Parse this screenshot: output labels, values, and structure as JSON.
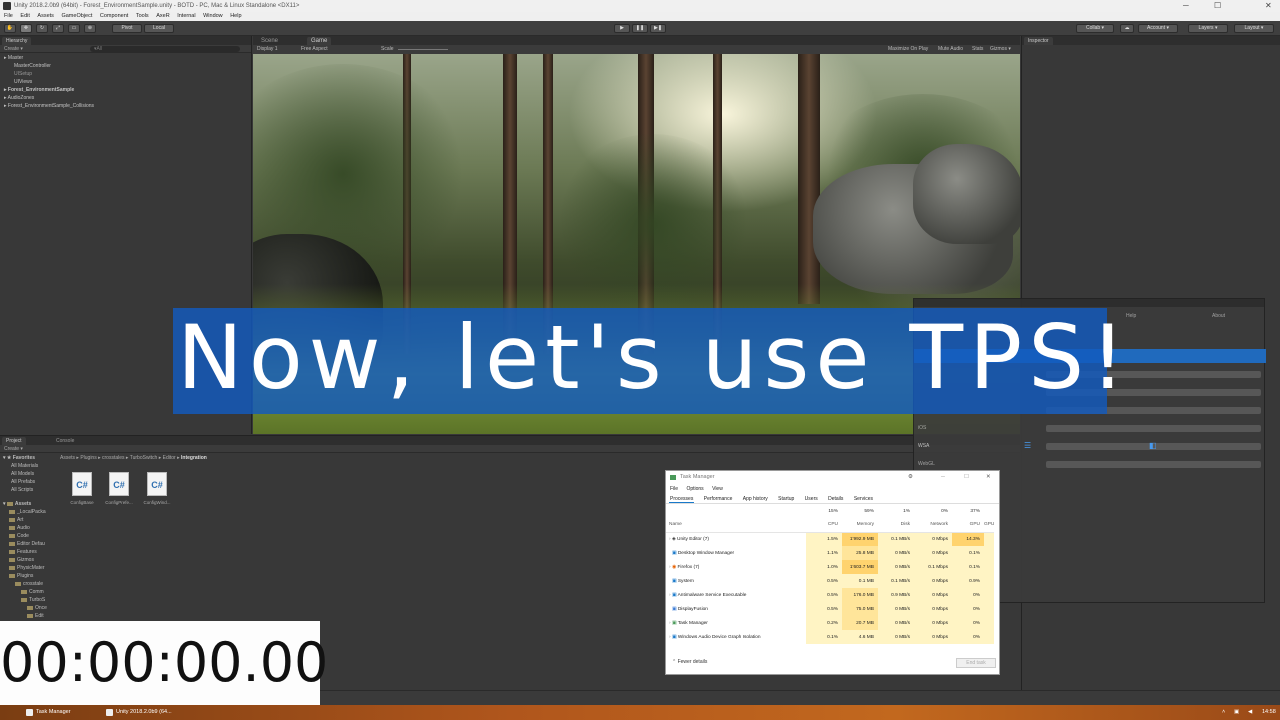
{
  "window": {
    "title": "Unity 2018.2.0b9 (64bit) - Forest_EnvironmentSample.unity - BOTD - PC, Mac & Linux Standalone <DX11>",
    "minimize": "─",
    "maximize": "☐",
    "close": "✕"
  },
  "menu": [
    "File",
    "Edit",
    "Assets",
    "GameObject",
    "Component",
    "Tools",
    "AxeR",
    "Internal",
    "Window",
    "Help"
  ],
  "toolbar": {
    "pivot": "Pivot",
    "local": "Local",
    "collab": "Collab ▾",
    "account": "Account ▾",
    "layers": "Layers ▾",
    "layout": "Layout ▾"
  },
  "hierarchy": {
    "tab": "Hierarchy",
    "create": "Create ▾",
    "search_placeholder": "▾All",
    "items": [
      "Master",
      "MasterController",
      "UISetup",
      "UIViews",
      "Forest_EnvironmentSample",
      "AudioZones",
      "Forest_EnvironmentSample_Collisions"
    ]
  },
  "scene_tabs": {
    "scene": "Scene",
    "game": "Game",
    "display": "Display 1",
    "aspect": "Free Aspect",
    "scale_label": "Scale",
    "maximize": "Maximize On Play",
    "mute": "Mute Audio",
    "stats": "Stats",
    "gizmos": "Gizmos ▾"
  },
  "inspector": {
    "tab": "Inspector"
  },
  "banner": {
    "text": "Now, let's use TPS!"
  },
  "project": {
    "tab_project": "Project",
    "tab_console": "Console",
    "create": "Create ▾",
    "breadcrumb": [
      "Assets",
      "Plugins",
      "crosstales",
      "TurboSwitch",
      "Editor",
      "Integration"
    ],
    "favorites_title": "Favorites",
    "favorites": [
      "All Materials",
      "All Models",
      "All Prefabs",
      "All Scripts"
    ],
    "assets_title": "Assets",
    "assets": [
      "_LocalPacka",
      "Art",
      "Audio",
      "Code",
      "Editor Defau",
      "Features",
      "Gizmos",
      "PhysicMater",
      "Plugins",
      "crosstale",
      "Comm",
      "TurboS",
      "Once",
      "Edit"
    ],
    "files": [
      {
        "icon": "C#",
        "label": "ConfigBase"
      },
      {
        "icon": "C#",
        "label": "ConfigPrefe..."
      },
      {
        "icon": "C#",
        "label": "ConfigWind..."
      }
    ]
  },
  "timer": {
    "value": "00:00:00.00"
  },
  "popup": {
    "help": "Help",
    "about": "About",
    "labels": [
      "",
      "",
      "",
      "",
      "iOS",
      "WSA",
      "WebGL"
    ]
  },
  "taskmgr": {
    "title": "Task Manager",
    "menu": [
      "File",
      "Options",
      "View"
    ],
    "tabs": [
      "Processes",
      "Performance",
      "App history",
      "Startup",
      "Users",
      "Details",
      "Services"
    ],
    "headers": {
      "name": "Name",
      "cpu_pct": "15%",
      "cpu": "CPU",
      "mem_pct": "59%",
      "mem": "Memory",
      "disk_pct": "1%",
      "disk": "Disk",
      "net_pct": "0%",
      "net": "Network",
      "gpu_pct": "37%",
      "gpu": "GPU",
      "gpu2": "GPU"
    },
    "rows": [
      {
        "name": "Unity Editor (7)",
        "cpu": "1.5%",
        "mem": "1'992.9 MB",
        "disk": "0.1 MB/s",
        "net": "0 Mbps",
        "gpu": "14.3%"
      },
      {
        "name": "Desktop Window Manager",
        "cpu": "1.1%",
        "mem": "25.8 MB",
        "disk": "0 MB/s",
        "net": "0 Mbps",
        "gpu": "0.1%"
      },
      {
        "name": "Firefox (7)",
        "cpu": "1.0%",
        "mem": "1'603.7 MB",
        "disk": "0 MB/s",
        "net": "0.1 Mbps",
        "gpu": "0.1%"
      },
      {
        "name": "System",
        "cpu": "0.5%",
        "mem": "0.1 MB",
        "disk": "0.1 MB/s",
        "net": "0 Mbps",
        "gpu": "0.9%"
      },
      {
        "name": "Antimalware Service Executable",
        "cpu": "0.5%",
        "mem": "176.0 MB",
        "disk": "0.9 MB/s",
        "net": "0 Mbps",
        "gpu": "0%"
      },
      {
        "name": "DisplayFusion",
        "cpu": "0.5%",
        "mem": "75.0 MB",
        "disk": "0 MB/s",
        "net": "0 Mbps",
        "gpu": "0%"
      },
      {
        "name": "Task Manager",
        "cpu": "0.2%",
        "mem": "20.7 MB",
        "disk": "0 MB/s",
        "net": "0 Mbps",
        "gpu": "0%"
      },
      {
        "name": "Windows Audio Device Graph Isolation",
        "cpu": "0.1%",
        "mem": "4.6 MB",
        "disk": "0 MB/s",
        "net": "0 Mbps",
        "gpu": "0%"
      }
    ],
    "fewer_details": "Fewer details",
    "end_task": "End task"
  },
  "taskbar": {
    "items": [
      "Task Manager",
      "Unity 2018.2.0b9 (64..."
    ],
    "clock": "14:58"
  },
  "colors": {
    "banner": "#125abe",
    "accent": "#1979ca"
  }
}
